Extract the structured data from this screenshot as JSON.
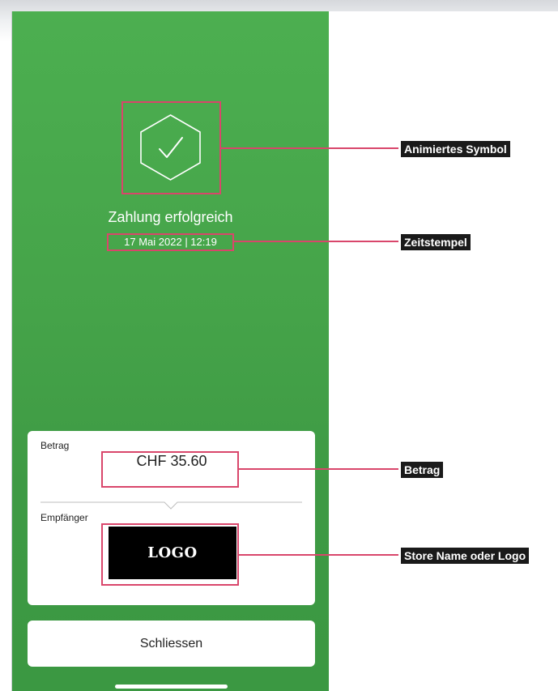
{
  "screen": {
    "success_title": "Zahlung erfolgreich",
    "timestamp": "17 Mai 2022 | 12:19",
    "status_icon": "check-hexagon-icon"
  },
  "card": {
    "amount_label": "Betrag",
    "amount_value": "CHF 35.60",
    "recipient_label": "Empfänger",
    "logo_text": "LOGO"
  },
  "actions": {
    "close_label": "Schliessen"
  },
  "annotations": {
    "icon_tag": "Animiertes Symbol",
    "timestamp_tag": "Zeitstempel",
    "amount_tag": "Betrag",
    "logo_tag": "Store Name oder Logo"
  },
  "colors": {
    "success_green": "#4caf50",
    "highlight": "#d9466b",
    "tag_bg": "#1a1a1a"
  }
}
